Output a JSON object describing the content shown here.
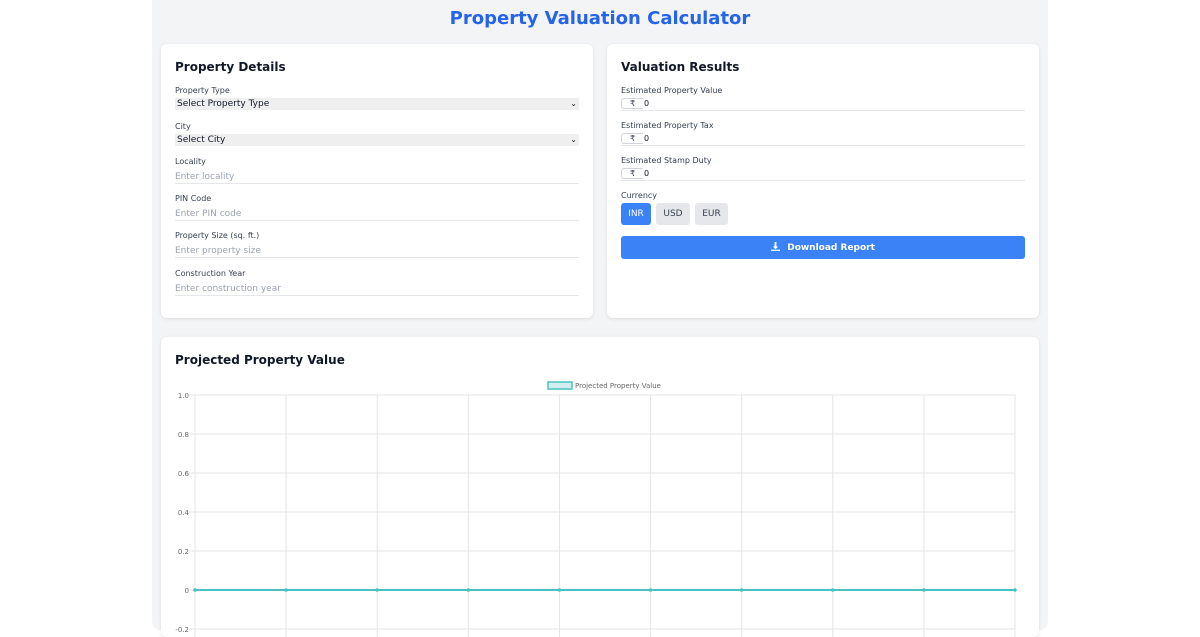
{
  "app": {
    "title": "Property Valuation Calculator"
  },
  "details": {
    "title": "Property Details",
    "property_type": {
      "label": "Property Type",
      "value": "Select Property Type"
    },
    "city": {
      "label": "City",
      "value": "Select City"
    },
    "locality": {
      "label": "Locality",
      "placeholder": "Enter locality"
    },
    "pin": {
      "label": "PIN Code",
      "placeholder": "Enter PIN code"
    },
    "size": {
      "label": "Property Size (sq. ft.)",
      "placeholder": "Enter property size"
    },
    "year": {
      "label": "Construction Year",
      "placeholder": "Enter construction year"
    }
  },
  "results": {
    "title": "Valuation Results",
    "currency_symbol": "₹",
    "value": {
      "label": "Estimated Property Value",
      "amount": "0"
    },
    "tax": {
      "label": "Estimated Property Tax",
      "amount": "0"
    },
    "stamp": {
      "label": "Estimated Stamp Duty",
      "amount": "0"
    },
    "currency": {
      "label": "Currency",
      "options": [
        "INR",
        "USD",
        "EUR"
      ],
      "selected": "INR"
    },
    "download_label": "Download Report",
    "download_icon": "download-icon"
  },
  "chart_section": {
    "title": "Projected Property Value"
  },
  "colors": {
    "accent": "#3b82f6",
    "title": "#2563eb",
    "series": "#4bc0c0"
  },
  "chart_data": {
    "type": "line",
    "series": [
      {
        "name": "Projected Property Value",
        "values": [
          0,
          0,
          0,
          0,
          0,
          0,
          0,
          0,
          0,
          0
        ]
      }
    ],
    "y_ticks": [
      "1.0",
      "0.8",
      "0.6",
      "0.4",
      "0.2",
      "0",
      "-0.2"
    ],
    "ylim": [
      -0.2,
      1.0
    ],
    "grid": true,
    "legend": "top-center"
  }
}
